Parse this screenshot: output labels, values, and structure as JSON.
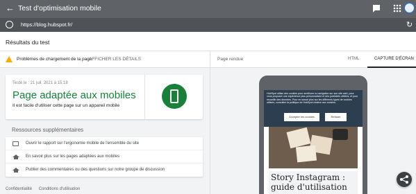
{
  "app": {
    "title": "Test d'optimisation mobile",
    "url": "https://blog.hubspot.fr/"
  },
  "results": {
    "heading": "Résultats du test",
    "issues_label": "Problèmes de chargement de la page",
    "issues_link": "AFFICHER LES DÉTAILS",
    "card": {
      "date": "Testé le : 21 juil. 2021 à 15:18",
      "title": "Page adaptée aux mobiles",
      "subtitle": "Il est facile d'utiliser cette page sur un appareil mobile"
    },
    "resources_title": "Ressources supplémentaires",
    "resources": [
      {
        "icon": "report-icon",
        "label": "Ouvrir le rapport sur l'ergonomie mobile de l'ensemble du site"
      },
      {
        "icon": "school-icon",
        "label": "En savoir plus sur les pages adaptées aux mobiles"
      },
      {
        "icon": "school-icon",
        "label": "Publier des commentaires ou des questions sur notre groupe de discussion"
      }
    ],
    "footer": [
      "Confidentialité",
      "Conditions d'utilisation"
    ]
  },
  "preview": {
    "rendered_label": "Page rendue",
    "tabs": [
      "HTML",
      "CAPTURE D'ÉCRAN"
    ],
    "active_tab": "CAPTURE D'ÉCRAN",
    "cookie_text": "HubSpot utilise des cookies pour améliorer la navigation sur son site web, pour vous proposer une expérience plus personnalisée et des publicités ciblées, et pour recueillir des données. Pour en savoir plus sur les différents types de cookies utilisés, consultez la politique de HubSpot relative aux cookies.",
    "accept_label": "Accepter les cookies",
    "refuse_label": "Refuser",
    "post_title": "Story Instagram : guide d'utilisation"
  },
  "colors": {
    "topbar": "#5f6368",
    "success": "#188038",
    "warning": "#f9ab00"
  }
}
